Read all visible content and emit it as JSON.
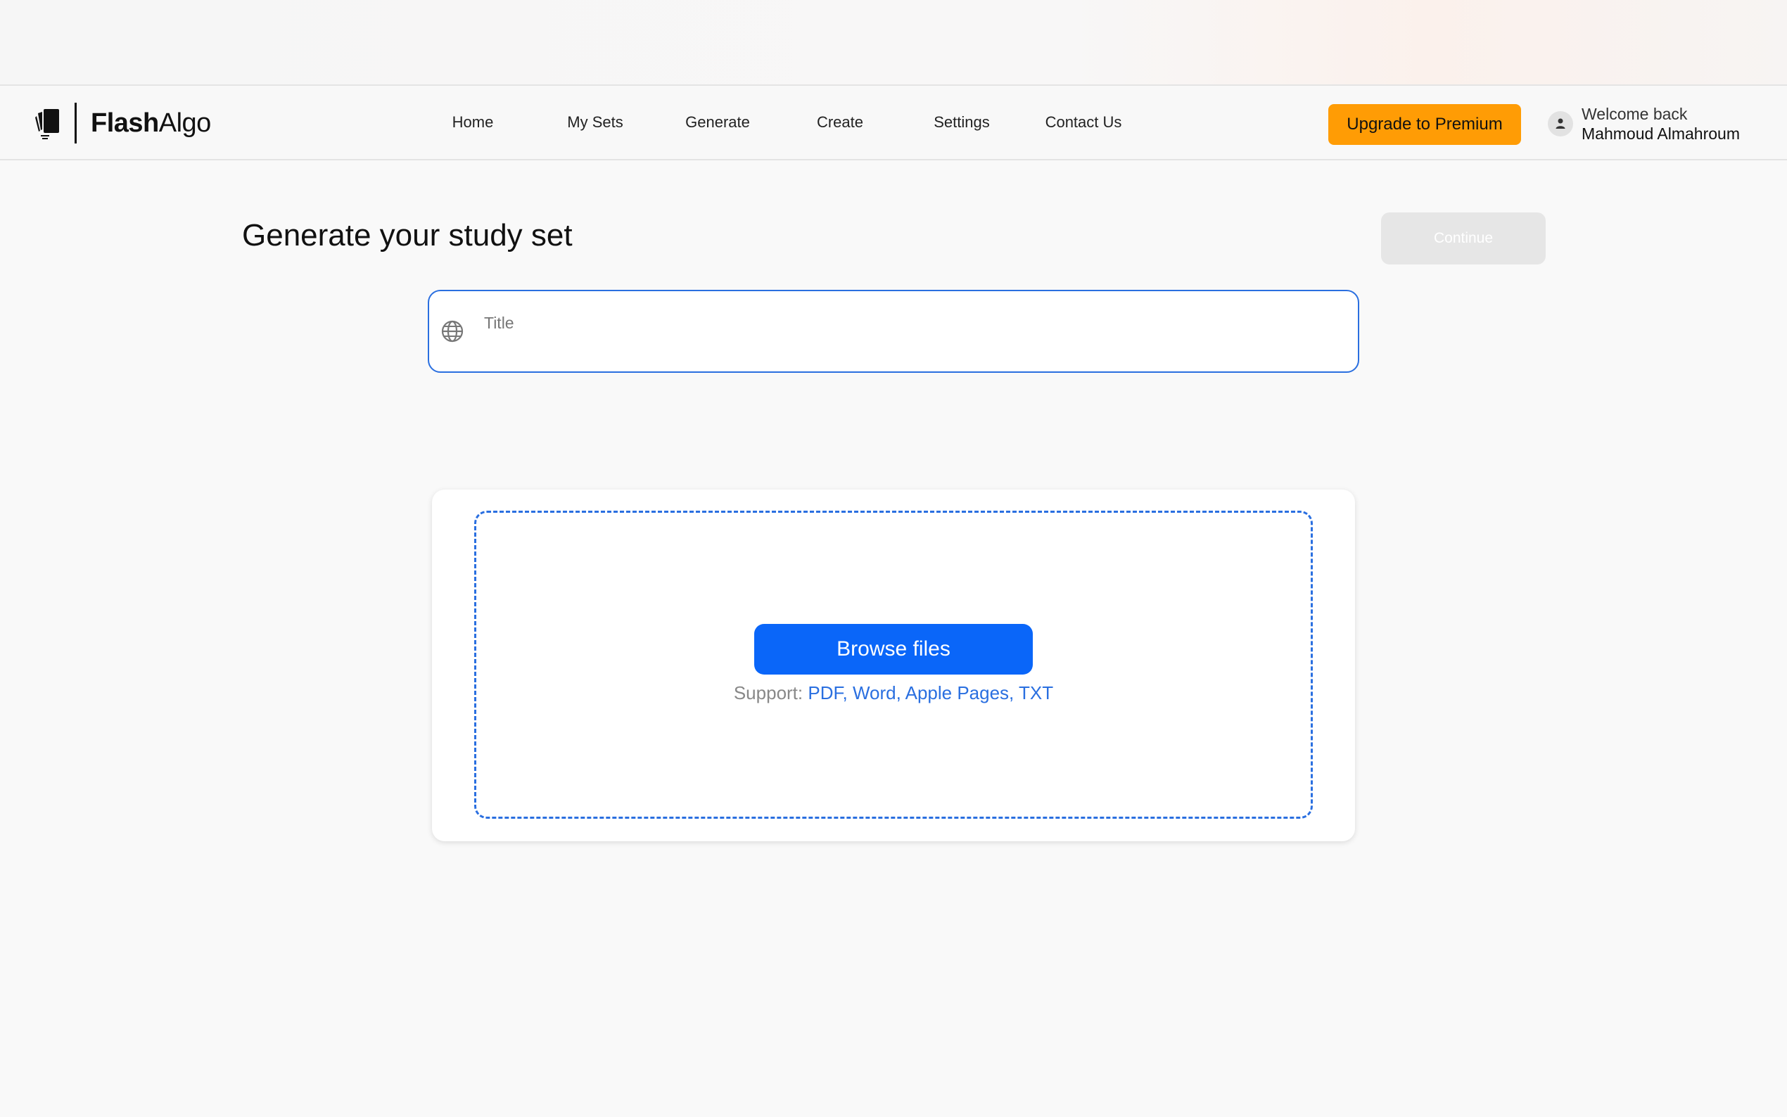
{
  "brand": {
    "name_bold": "Flash",
    "name_regular": "Algo"
  },
  "nav": {
    "items": [
      {
        "label": "Home"
      },
      {
        "label": "My Sets"
      },
      {
        "label": "Generate"
      },
      {
        "label": "Create"
      },
      {
        "label": "Settings"
      },
      {
        "label": "Contact Us"
      }
    ]
  },
  "header": {
    "upgrade_label": "Upgrade to Premium",
    "welcome": "Welcome back",
    "user_name": "Mahmoud Almahroum",
    "avatar_icon": "user-icon"
  },
  "main": {
    "title": "Generate your study set",
    "continue_label": "Continue",
    "title_input": {
      "placeholder": "Title",
      "value": "",
      "icon": "globe-icon"
    },
    "upload": {
      "browse_label": "Browse files",
      "support_label": "Support:",
      "support_formats": "PDF, Word, Apple Pages, TXT"
    }
  },
  "colors": {
    "accent_blue": "#0a66f9",
    "border_blue": "#2a6fe0",
    "premium_orange": "#ff9c05",
    "disabled_gray": "#e6e6e6"
  }
}
